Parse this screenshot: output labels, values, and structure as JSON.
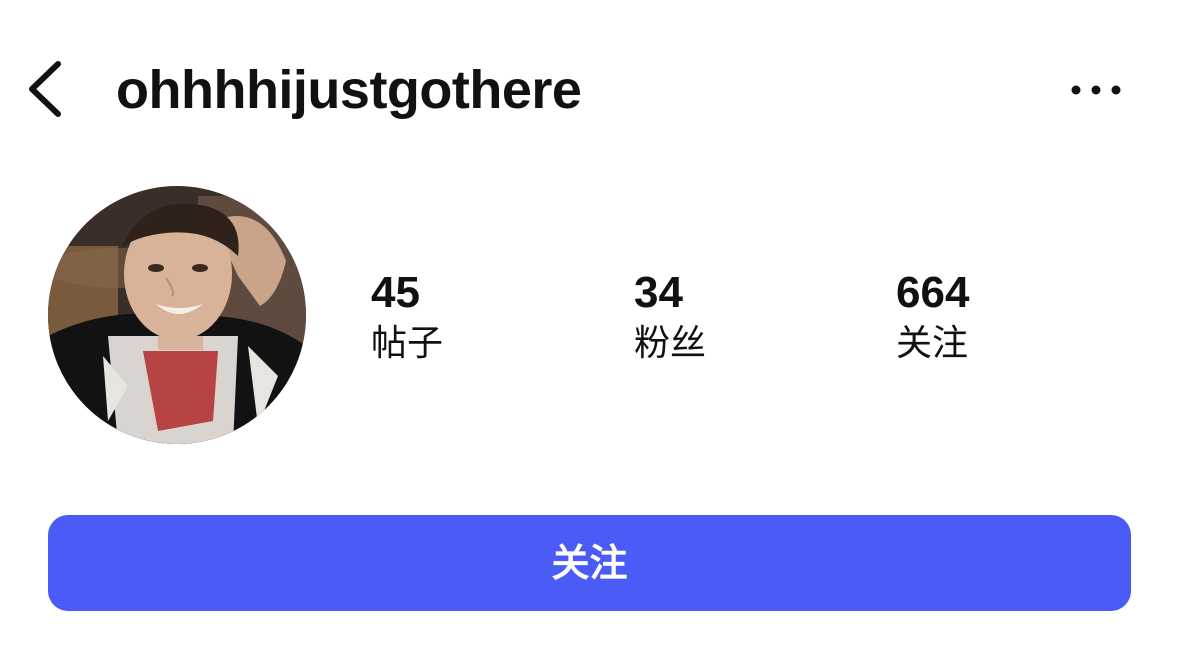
{
  "header": {
    "back_icon": "chevron-left-icon",
    "username": "ohhhhijustgothere",
    "more_icon": "more-horizontal-icon"
  },
  "profile": {
    "avatar": "profile-photo",
    "stats": [
      {
        "count": "45",
        "label": "帖子"
      },
      {
        "count": "34",
        "label": "粉丝"
      },
      {
        "count": "664",
        "label": "关注"
      }
    ]
  },
  "actions": {
    "follow_label": "关注"
  },
  "colors": {
    "accent": "#4a5cf5",
    "text": "#111111",
    "background": "#ffffff"
  }
}
